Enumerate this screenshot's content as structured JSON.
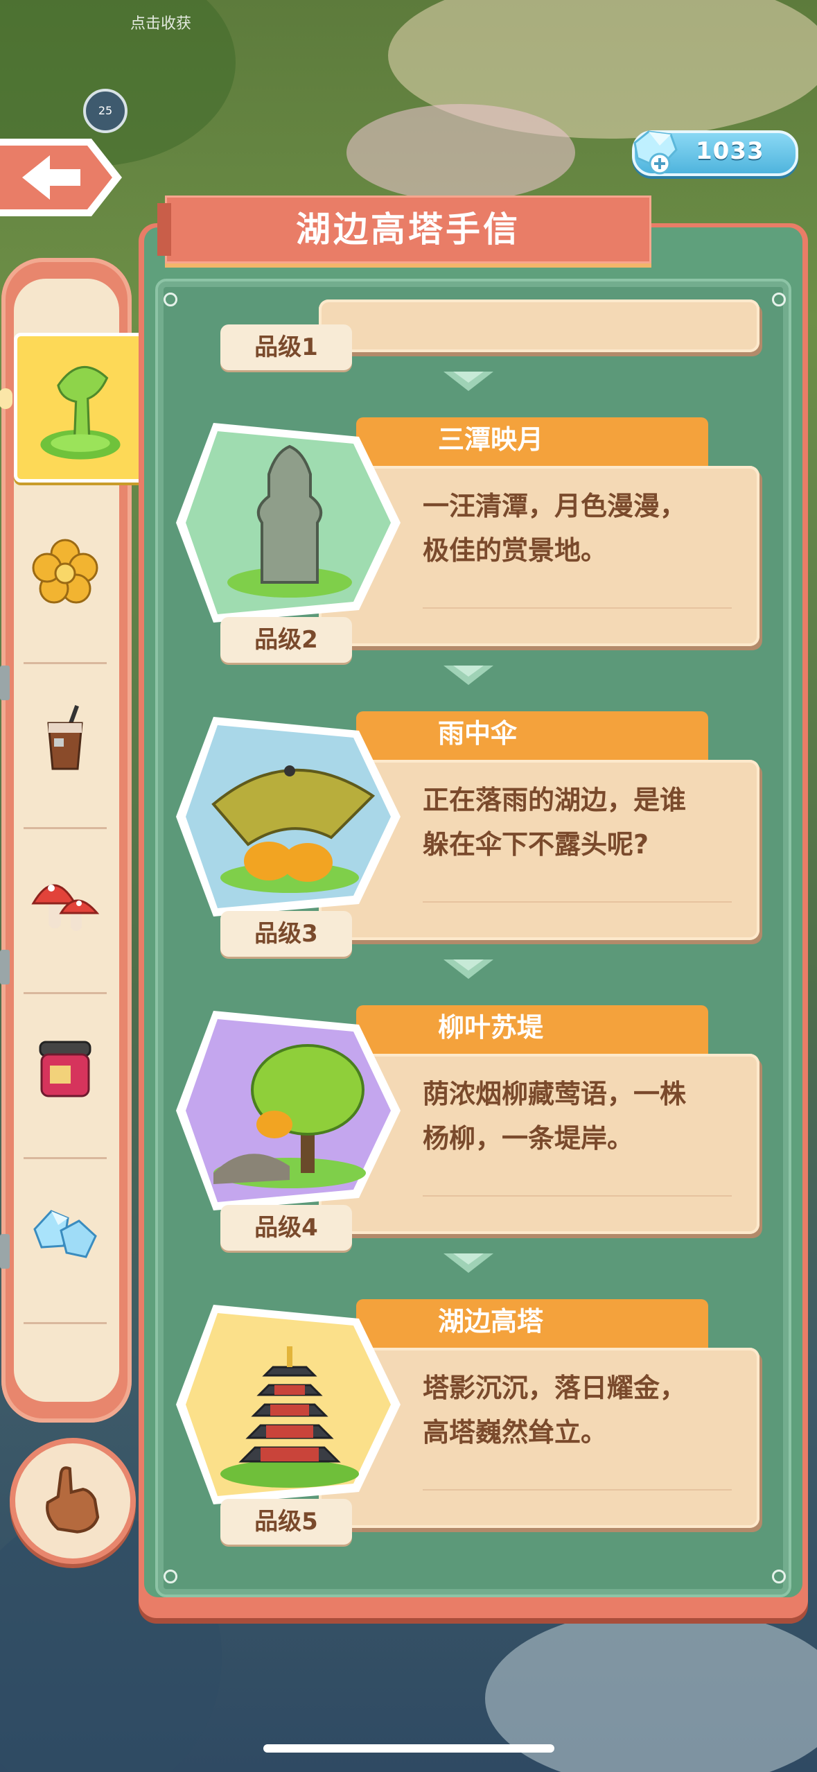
{
  "background": {
    "hint_text": "点击收获",
    "timer_value": "25"
  },
  "currency": {
    "gems": "1033"
  },
  "panel": {
    "title": "湖边高塔手信"
  },
  "levels": [
    {
      "level_label": "品级1",
      "name": "",
      "description": ""
    },
    {
      "level_label": "品级2",
      "name": "三潭映月",
      "description_line1": "一汪清潭，月色漫漫，",
      "description_line2": "极佳的赏景地。"
    },
    {
      "level_label": "品级3",
      "name": "雨中伞",
      "description_line1": "正在落雨的湖边，是谁",
      "description_line2": "躲在伞下不露头呢?"
    },
    {
      "level_label": "品级4",
      "name": "柳叶苏堤",
      "description_line1": "荫浓烟柳藏莺语，一株",
      "description_line2": "杨柳，一条堤岸。"
    },
    {
      "level_label": "品级5",
      "name": "湖边高塔",
      "description_line1": "塔影沉沉，落日耀金，",
      "description_line2": "高塔巍然耸立。"
    }
  ],
  "categories": [
    {
      "icon": "slime-icon",
      "selected": true
    },
    {
      "icon": "gold-flower-icon",
      "selected": false
    },
    {
      "icon": "iced-coffee-icon",
      "selected": false
    },
    {
      "icon": "mushroom-icon",
      "selected": false
    },
    {
      "icon": "canned-jar-icon",
      "selected": false
    },
    {
      "icon": "diamond-icon",
      "selected": false
    }
  ],
  "colors": {
    "panel_frame": "#e97d67",
    "panel_green": "#5fa07c",
    "card": "#f4d9b5",
    "name_tab": "#f4a23c",
    "text_brown": "#7a4a2c",
    "selected_category": "#fdd957"
  }
}
